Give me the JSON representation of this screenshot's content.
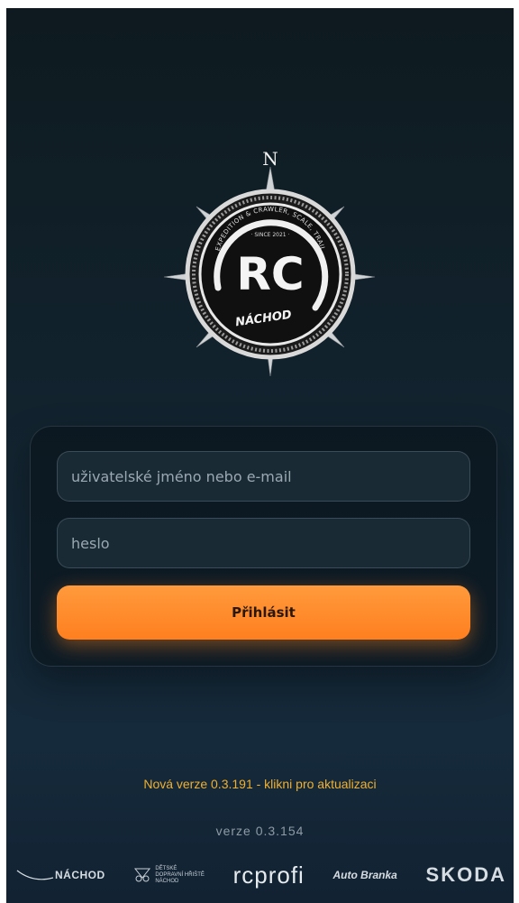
{
  "logo": {
    "compass_letter": "N",
    "ring_text_top": "EXPEDITION & CRAWLER, SCALE, TRAIL",
    "since_text": "· SINCE 2021 ·",
    "monogram": "RC",
    "city_text": "NÁCHOD"
  },
  "login": {
    "username_placeholder": "uživatelské jméno nebo e-mail",
    "password_placeholder": "heslo",
    "submit_label": "Přihlásit"
  },
  "update_notice": "Nová verze 0.3.191 - klikni pro aktualizaci",
  "version_text": "verze 0.3.154",
  "sponsors": {
    "nachod": "NÁCHOD",
    "dopravni": "DĚTSKÉ\nDOPRAVNÍ HŘIŠTĚ\nNÁCHOD",
    "rcprofi": "rcprofi",
    "autobranka": "Auto Branka",
    "skoda": "SKODA"
  },
  "colors": {
    "accent": "#ff8a2a",
    "update_text": "#f0b030",
    "background": "#132532"
  }
}
